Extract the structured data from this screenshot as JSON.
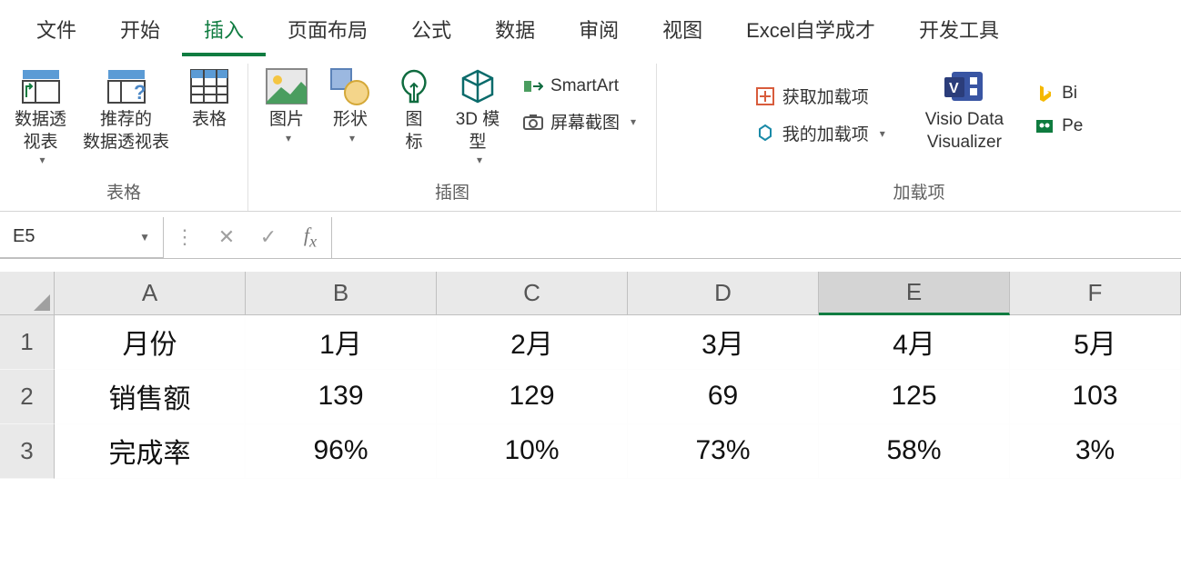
{
  "tabs": {
    "file": "文件",
    "home": "开始",
    "insert": "插入",
    "layout": "页面布局",
    "formulas": "公式",
    "data": "数据",
    "review": "审阅",
    "view": "视图",
    "custom": "Excel自学成才",
    "dev": "开发工具"
  },
  "ribbon": {
    "tables": {
      "pivot": "数据透\n视表",
      "recommend": "推荐的\n数据透视表",
      "table": "表格",
      "group": "表格"
    },
    "illus": {
      "picture": "图片",
      "shapes": "形状",
      "icons": "图\n标",
      "model": "3D 模\n型",
      "smartart": "SmartArt",
      "screenshot": "屏幕截图",
      "group": "插图"
    },
    "addins": {
      "get": "获取加载项",
      "my": "我的加载项",
      "visio": "Visio Data\nVisualizer",
      "bing": "Bi",
      "people": "Pe",
      "group": "加载项"
    }
  },
  "namebox": "E5",
  "columns": [
    "A",
    "B",
    "C",
    "D",
    "E",
    "F"
  ],
  "selected_col_index": 4,
  "rows": [
    "1",
    "2",
    "3"
  ],
  "sheet": [
    [
      "月份",
      "1月",
      "2月",
      "3月",
      "4月",
      "5月"
    ],
    [
      "销售额",
      "139",
      "129",
      "69",
      "125",
      "103"
    ],
    [
      "完成率",
      "96%",
      "10%",
      "73%",
      "58%",
      "3%"
    ]
  ]
}
